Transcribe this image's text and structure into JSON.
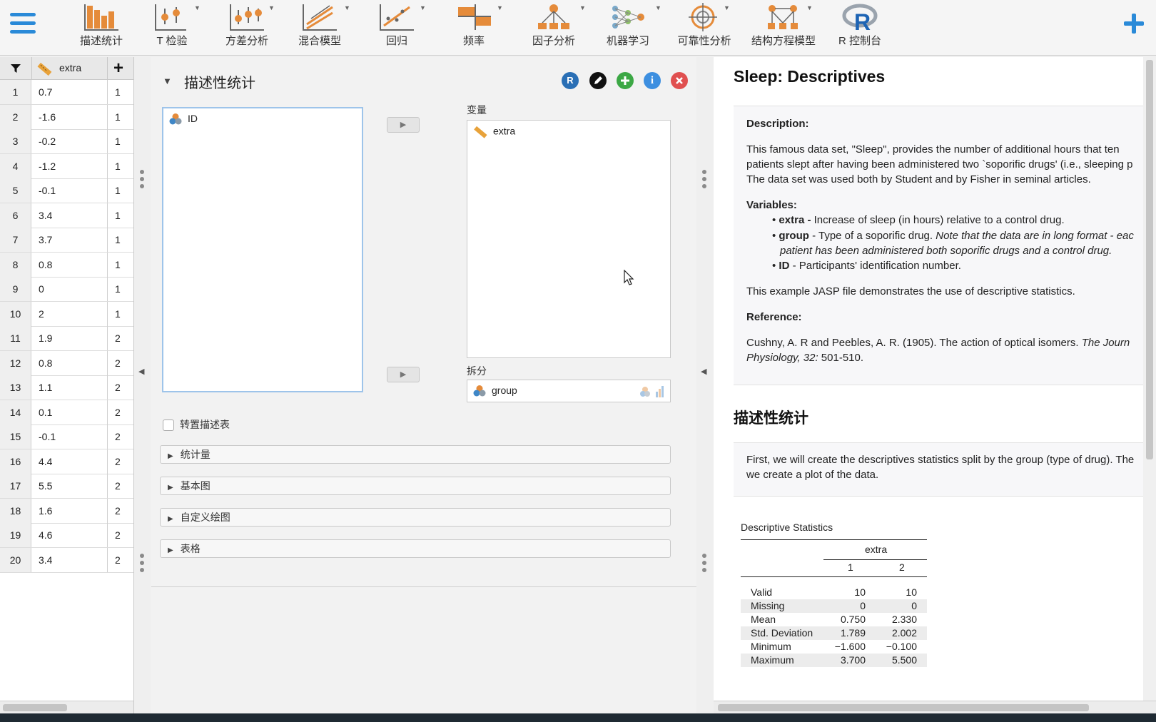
{
  "toolbar": {
    "tools": [
      {
        "label": "描述统计"
      },
      {
        "label": "T 检验"
      },
      {
        "label": "方差分析"
      },
      {
        "label": "混合模型"
      },
      {
        "label": "回归"
      },
      {
        "label": "频率"
      },
      {
        "label": "因子分析"
      },
      {
        "label": "机器学习"
      },
      {
        "label": "可靠性分析"
      },
      {
        "label": "结构方程模型"
      },
      {
        "label": "R 控制台"
      }
    ],
    "accent": "#2a8ad8"
  },
  "grid": {
    "col1_header": "extra",
    "rows": [
      [
        "1",
        "0.7",
        "1"
      ],
      [
        "2",
        "-1.6",
        "1"
      ],
      [
        "3",
        "-0.2",
        "1"
      ],
      [
        "4",
        "-1.2",
        "1"
      ],
      [
        "5",
        "-0.1",
        "1"
      ],
      [
        "6",
        "3.4",
        "1"
      ],
      [
        "7",
        "3.7",
        "1"
      ],
      [
        "8",
        "0.8",
        "1"
      ],
      [
        "9",
        "0",
        "1"
      ],
      [
        "10",
        "2",
        "1"
      ],
      [
        "11",
        "1.9",
        "2"
      ],
      [
        "12",
        "0.8",
        "2"
      ],
      [
        "13",
        "1.1",
        "2"
      ],
      [
        "14",
        "0.1",
        "2"
      ],
      [
        "15",
        "-0.1",
        "2"
      ],
      [
        "16",
        "4.4",
        "2"
      ],
      [
        "17",
        "5.5",
        "2"
      ],
      [
        "18",
        "1.6",
        "2"
      ],
      [
        "19",
        "4.6",
        "2"
      ],
      [
        "20",
        "3.4",
        "2"
      ]
    ]
  },
  "analysis": {
    "title": "描述性统计",
    "source_item": "ID",
    "variables_label": "变量",
    "variable_item": "extra",
    "split_label": "拆分",
    "split_item": "group",
    "transpose_label": "转置描述表",
    "sections": [
      {
        "label": "统计量"
      },
      {
        "label": "基本图"
      },
      {
        "label": "自定义绘图"
      },
      {
        "label": "表格"
      }
    ],
    "header_icons": {
      "r": "R",
      "info": "i"
    }
  },
  "results": {
    "title": "Sleep: Descriptives",
    "description_heading": "Description:",
    "description_lines": [
      "This famous data set, \"Sleep\", provides the number of additional hours that ten",
      "patients slept after having been administered two `soporific drugs' (i.e., sleeping p",
      "The data set was used both by Student and by Fisher in seminal articles."
    ],
    "variables_heading": "Variables:",
    "var_extra_name": "extra -",
    "var_extra_desc": " Increase of sleep (in hours) relative to a control drug.",
    "var_group_name": "group",
    "var_group_desc": " - Type of a soporific drug. ",
    "var_group_note1": "Note that the data are in long format - eac",
    "var_group_note2": "patient has been administered both soporific drugs and a control drug.",
    "var_id_name": "ID",
    "var_id_desc": " - Participants' identification number.",
    "example_text": "This example JASP file demonstrates the use of descriptive statistics.",
    "reference_heading": "Reference:",
    "reference_line1": "Cushny, A. R and Peebles, A. R. (1905). The action of optical isomers. ",
    "reference_journal1": "The Journ",
    "reference_journal2": "Physiology, 32:",
    "reference_pages": " 501-510.",
    "section_title": "描述性统计",
    "intro_line1": "First, we will create the descriptives statistics split by the group (type of drug). The",
    "intro_line2": "we create a plot of the data.",
    "table": {
      "caption": "Descriptive Statistics",
      "variable": "extra",
      "groups": [
        "1",
        "2"
      ],
      "rows": [
        {
          "label": "Valid",
          "g1": "10",
          "g2": "10"
        },
        {
          "label": "Missing",
          "g1": "0",
          "g2": "0"
        },
        {
          "label": "Mean",
          "g1": "0.750",
          "g2": "2.330"
        },
        {
          "label": "Std. Deviation",
          "g1": "1.789",
          "g2": "2.002"
        },
        {
          "label": "Minimum",
          "g1": "−1.600",
          "g2": "−0.100"
        },
        {
          "label": "Maximum",
          "g1": "3.700",
          "g2": "5.500"
        }
      ]
    }
  }
}
